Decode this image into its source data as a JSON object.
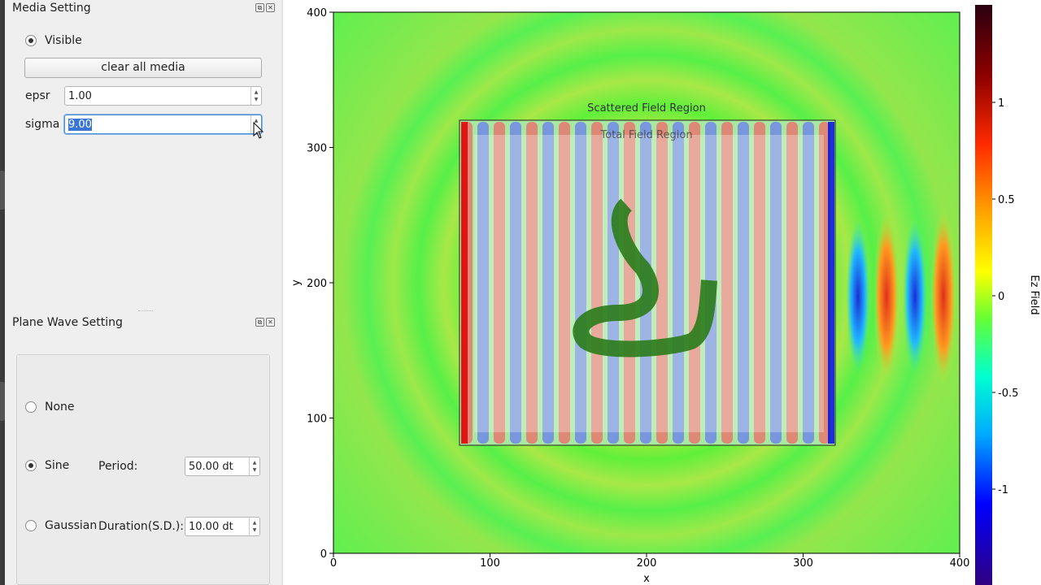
{
  "media_setting": {
    "title": "Media Setting",
    "visible_label": "Visible",
    "visible_checked": true,
    "clear_button": "clear all media",
    "epsr_label": "epsr",
    "epsr_value": "1.00",
    "sigma_label": "sigma",
    "sigma_value": "9.00"
  },
  "plane_wave_setting": {
    "title": "Plane Wave Setting",
    "options": {
      "none": "None",
      "sine": "Sine",
      "gaussian": "Gaussian"
    },
    "selected": "Sine",
    "period_label": "Period:",
    "period_value": "50.00 dt",
    "duration_label": "Duration(S.D.):",
    "duration_value": "10.00 dt"
  },
  "dock_buttons": {
    "float": "⧉",
    "close": "✕"
  },
  "plot": {
    "xlabel": "x",
    "ylabel": "y",
    "xticks": [
      "0",
      "100",
      "200",
      "300",
      "400"
    ],
    "yticks": [
      "400",
      "300",
      "200",
      "100",
      "0"
    ],
    "region_scattered": "Scattered Field Region",
    "region_total": "Total Field Region",
    "colorbar_label": "Ez Field",
    "colorbar_ticks": [
      "1",
      "0.5",
      "0",
      "-0.5",
      "-1"
    ],
    "colormap": [
      "#2a0010",
      "#8b0000",
      "#ff2a00",
      "#ffa500",
      "#ffff00",
      "#66ff33",
      "#00ffd0",
      "#00aaff",
      "#0000ff",
      "#300080"
    ]
  }
}
